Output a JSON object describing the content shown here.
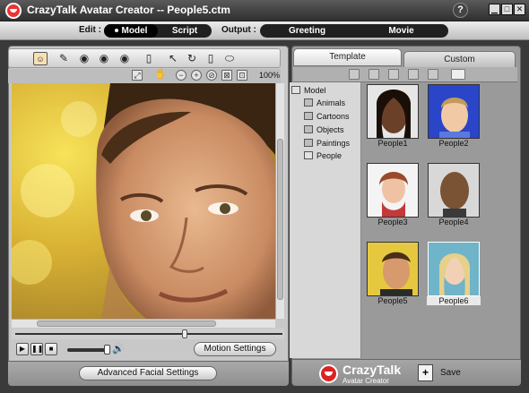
{
  "window": {
    "title": "CrazyTalk Avatar Creator -- People5.ctm",
    "help_label": "?",
    "controls": [
      "▁",
      "□",
      "✕"
    ]
  },
  "modebar": {
    "edit_label": "Edit :",
    "edit_modes": [
      "Model",
      "Script"
    ],
    "output_label": "Output :",
    "output_modes": [
      "Greeting",
      "Movie"
    ]
  },
  "viewer": {
    "zoom": "100%"
  },
  "playback": {
    "motion_settings_label": "Motion Settings",
    "advanced_label": "Advanced Facial Settings"
  },
  "library": {
    "tabs": [
      "Template",
      "Custom"
    ],
    "tree": [
      "Model",
      "Animals",
      "Cartoons",
      "Objects",
      "Paintings",
      "People"
    ],
    "items": [
      "People1",
      "People2",
      "People3",
      "People4",
      "People5",
      "People6"
    ],
    "selected": "People6"
  },
  "brand": {
    "name": "CrazyTalk",
    "sub": "Avatar Creator",
    "save_label": "Save"
  },
  "colors": {
    "frame": "#3a3a3a",
    "panel": "#c8c8c8",
    "library_bg": "#9a9a9a",
    "accent_red": "#dd2222"
  }
}
